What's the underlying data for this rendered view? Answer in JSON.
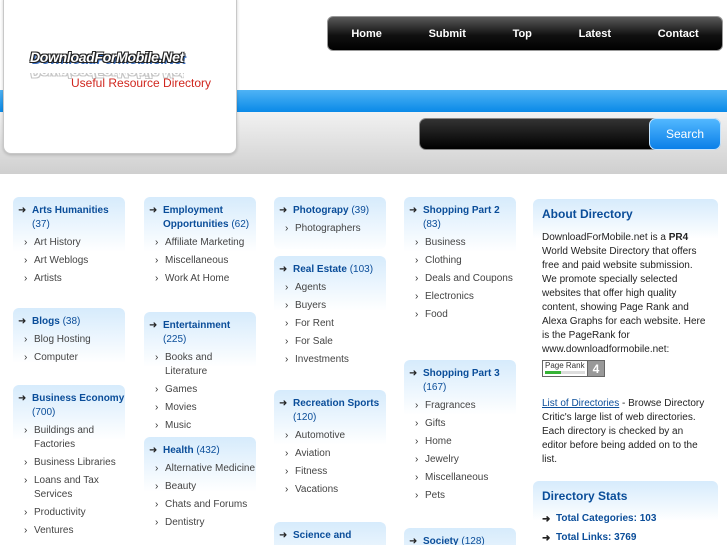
{
  "header": {
    "logo_text": "DownloadForMobile.Net",
    "tagline": "Useful Resource Directory",
    "nav": [
      "Home",
      "Submit",
      "Top",
      "Latest",
      "Contact"
    ],
    "search_button": "Search"
  },
  "categories": [
    {
      "name": "Arts Humanities",
      "count": "(37)",
      "subs": [
        "Art History",
        "Art Weblogs",
        "Artists"
      ]
    },
    {
      "name": "Blogs",
      "count": "(38)",
      "subs": [
        "Blog Hosting",
        "Computer"
      ]
    },
    {
      "name": "Business Economy",
      "count": "(700)",
      "subs": [
        "Buildings and Factories",
        "Business Libraries",
        "Loans and Tax Services",
        "Productivity",
        "Ventures"
      ]
    },
    {
      "name": "Employment Opportunities",
      "count": "(62)",
      "subs": [
        "Affiliate Marketing",
        "Miscellaneous",
        "Work At Home"
      ]
    },
    {
      "name": "Entertainment",
      "count": "(225)",
      "subs": [
        "Books and Literature",
        "Games",
        "Movies",
        "Music"
      ]
    },
    {
      "name": "Health",
      "count": "(432)",
      "subs": [
        "Alternative Medicine",
        "Beauty",
        "Chats and Forums",
        "Dentistry"
      ]
    },
    {
      "name": "Photograpy",
      "count": "(39)",
      "subs": [
        "Photographers"
      ]
    },
    {
      "name": "Real Estate",
      "count": "(103)",
      "subs": [
        "Agents",
        "Buyers",
        "For Rent",
        "For Sale",
        "Investments"
      ]
    },
    {
      "name": "Recreation Sports",
      "count": "(120)",
      "subs": [
        "Automotive",
        "Aviation",
        "Fitness",
        "Vacations"
      ]
    },
    {
      "name": "Science and",
      "count": "",
      "subs": []
    },
    {
      "name": "Shopping Part 2",
      "count": "(83)",
      "subs": [
        "Business",
        "Clothing",
        "Deals and Coupons",
        "Electronics",
        "Food"
      ]
    },
    {
      "name": "Shopping Part 3",
      "count": "(167)",
      "subs": [
        "Fragrances",
        "Gifts",
        "Home",
        "Jewelry",
        "Miscellaneous",
        "Pets"
      ]
    },
    {
      "name": "Society",
      "count": "(128)",
      "subs": []
    }
  ],
  "about": {
    "title": "About Directory",
    "text_1": "DownloadForMobile.net is a",
    "pr_strong": "PR4",
    "text_2": "World Website Directory that offers free and paid website submission. We promote specially selected websites that offer high quality content, showing Page Rank and Alexa Graphs for each website. Here is the PageRank for www.downloadformobile.net:",
    "pagerank_label": "Page Rank",
    "pagerank_value": "4",
    "pagerank_fraction": 0.4,
    "link_text": "List of Directories",
    "link_desc": " - Browse Directory Critic's large list of web directories. Each directory is checked by an editor before being added on to the list."
  },
  "stats": {
    "title": "Directory Stats",
    "items": [
      "Total Categories: 103",
      "Total Links: 3769"
    ]
  }
}
